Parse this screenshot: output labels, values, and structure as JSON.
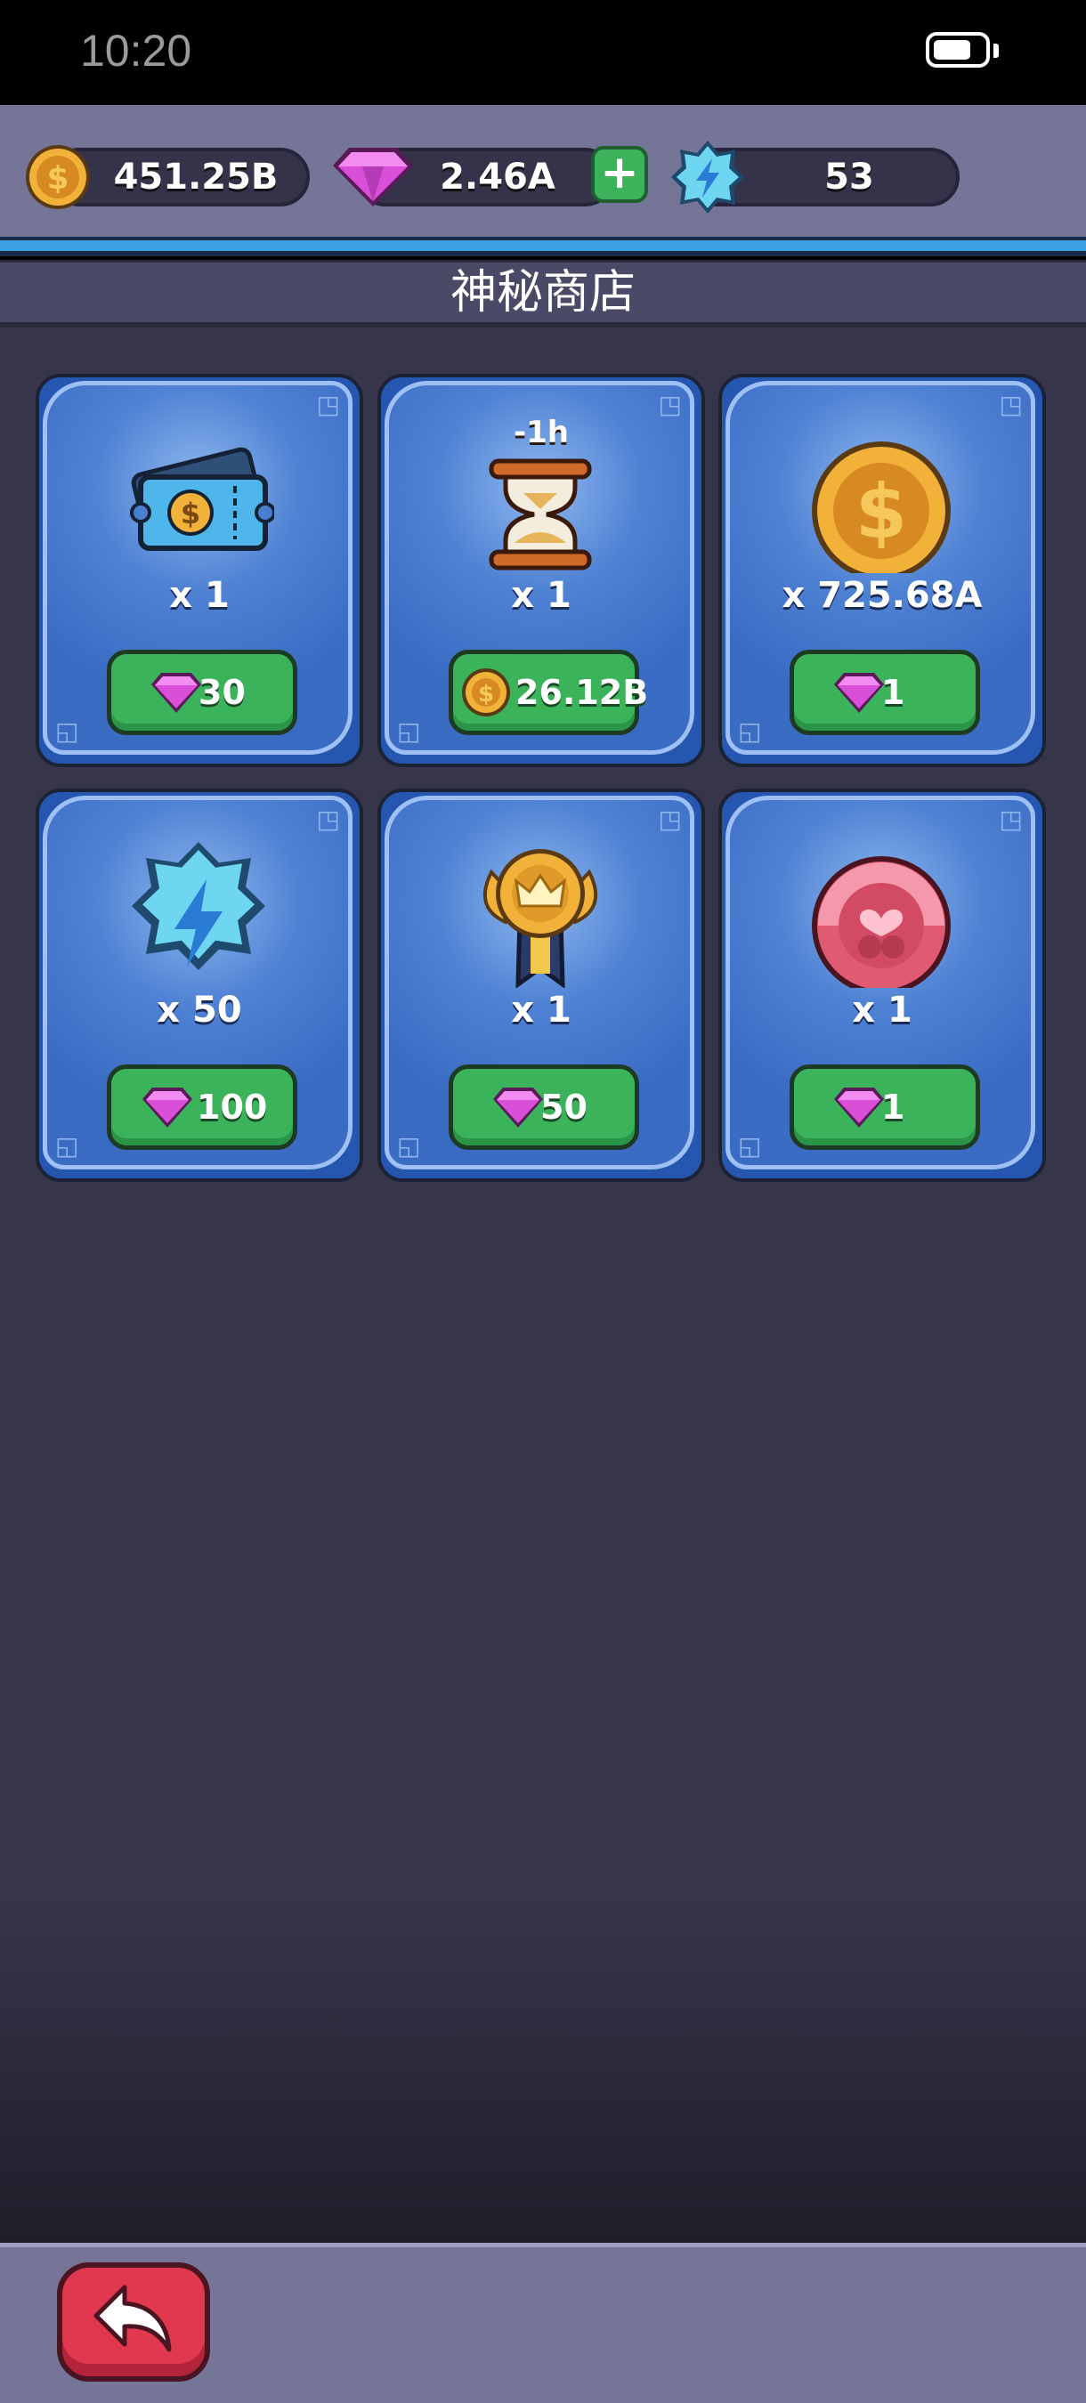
{
  "status_bar": {
    "time": "10:20",
    "battery_level": 0.75
  },
  "resources": {
    "coins": {
      "value": "451.25B",
      "icon": "coin-icon"
    },
    "gems": {
      "value": "2.46A",
      "icon": "gem-icon",
      "add_label": "+"
    },
    "energy": {
      "value": "53",
      "icon": "energy-icon"
    }
  },
  "shop": {
    "title": "神秘商店",
    "items": [
      {
        "icon": "ticket-icon",
        "quantity": "x 1",
        "price": "30",
        "currency": "gem"
      },
      {
        "icon": "hourglass-icon",
        "icon_label": "-1h",
        "quantity": "x 1",
        "price": "26.12B",
        "currency": "coin"
      },
      {
        "icon": "coin-icon",
        "quantity": "x 725.68A",
        "price": "1",
        "currency": "gem"
      },
      {
        "icon": "energy-icon",
        "quantity": "x 50",
        "price": "100",
        "currency": "gem"
      },
      {
        "icon": "medal-icon",
        "quantity": "x 1",
        "price": "50",
        "currency": "gem"
      },
      {
        "icon": "heart-orb-icon",
        "quantity": "x 1",
        "price": "1",
        "currency": "gem"
      }
    ]
  },
  "nav": {
    "back_icon": "back-arrow-icon"
  },
  "colors": {
    "accent_green": "#3bb35b",
    "card_blue": "#3a6cc4",
    "back_red": "#e0384e",
    "bar": "#757597"
  }
}
